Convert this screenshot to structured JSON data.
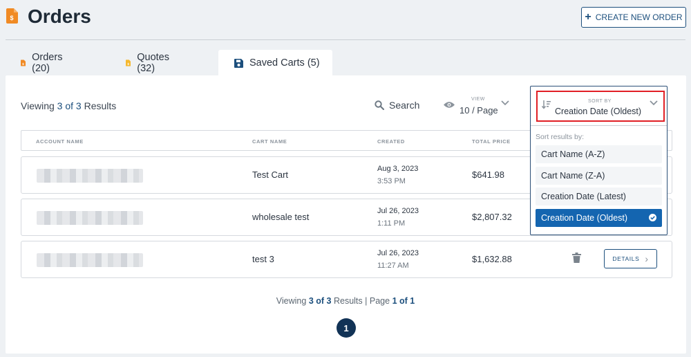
{
  "header": {
    "title": "Orders",
    "create_button": "CREATE NEW ORDER",
    "accent_color": "#f08a24"
  },
  "tabs": [
    {
      "label": "Orders (20)",
      "icon": "orders-doc-icon",
      "active": false
    },
    {
      "label": "Quotes (32)",
      "icon": "quotes-doc-icon",
      "active": false
    },
    {
      "label": "Saved Carts (5)",
      "icon": "save-disk-icon",
      "active": true
    }
  ],
  "toolbar": {
    "viewing_prefix": "Viewing",
    "viewing_count": "3 of 3",
    "viewing_suffix": "Results",
    "search_label": "Search",
    "view_label": "VIEW",
    "view_value": "10 / Page"
  },
  "sort": {
    "label": "SORT BY",
    "value": "Creation Date (Oldest)",
    "hint": "Sort results by:",
    "options": [
      {
        "label": "Cart Name (A-Z)",
        "selected": false
      },
      {
        "label": "Cart Name (Z-A)",
        "selected": false
      },
      {
        "label": "Creation Date (Latest)",
        "selected": false
      },
      {
        "label": "Creation Date (Oldest)",
        "selected": true
      }
    ]
  },
  "table": {
    "columns": [
      "ACCOUNT NAME",
      "CART NAME",
      "CREATED",
      "TOTAL PRICE"
    ],
    "rows": [
      {
        "cart_name": "Test Cart",
        "date": "Aug 3, 2023",
        "time": "3:53 PM",
        "price": "$641.98"
      },
      {
        "cart_name": "wholesale test",
        "date": "Jul 26, 2023",
        "time": "1:11 PM",
        "price": "$2,807.32"
      },
      {
        "cart_name": "test 3",
        "date": "Jul 26, 2023",
        "time": "11:27 AM",
        "price": "$1,632.88",
        "details_label": "DETAILS"
      }
    ]
  },
  "footer": {
    "viewing_prefix": "Viewing",
    "viewing_count": "3 of 3",
    "viewing_suffix": "Results",
    "separator": "|",
    "page_prefix": "Page",
    "page_value": "1 of 1",
    "current_page": "1"
  },
  "colors": {
    "primary": "#1c4f7d",
    "selected": "#1465b0",
    "highlight_border": "#e11f25"
  }
}
